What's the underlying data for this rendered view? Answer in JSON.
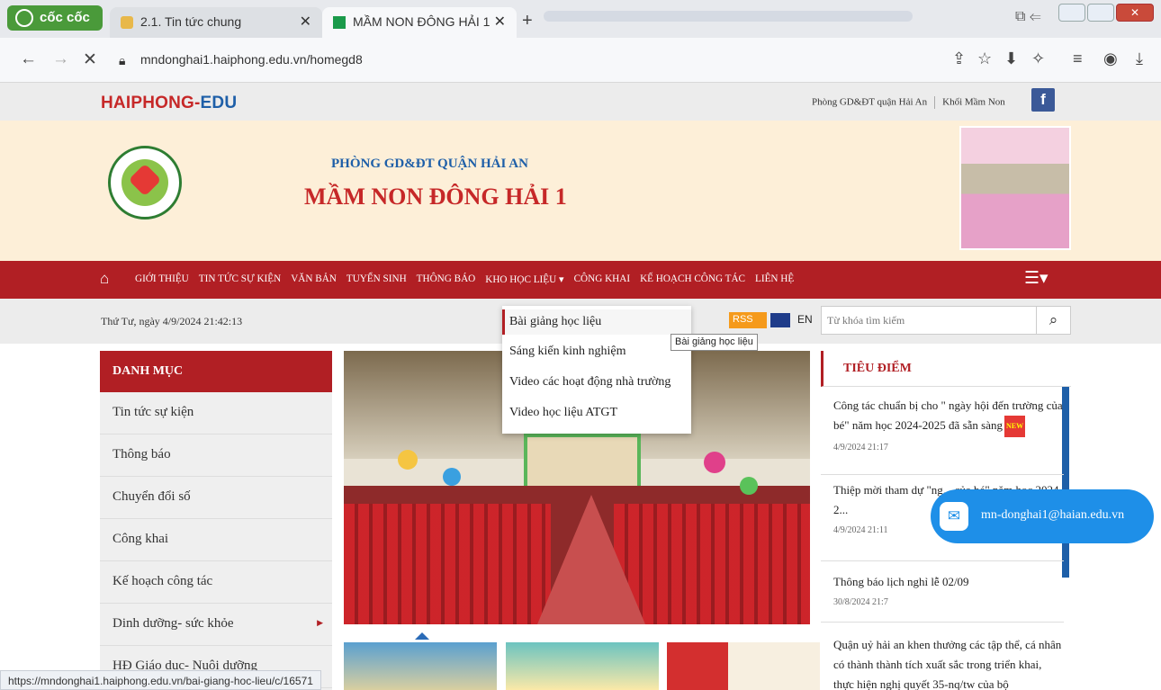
{
  "browser": {
    "brand": "cốc cốc",
    "tabs": [
      {
        "title": "2.1. Tin tức chung",
        "close": "✕"
      },
      {
        "title": "MẦM NON ĐÔNG HẢI 1",
        "close": "✕"
      }
    ],
    "new_tab": "+",
    "url": "mndonghai1.haiphong.edu.vn/homegd8"
  },
  "site": {
    "logo_main": "HAIPHONG-",
    "logo_edu": "EDU",
    "top_links": [
      "Phòng GD&ĐT quận Hải An",
      "Khối Mầm Non"
    ],
    "fb": "f"
  },
  "banner": {
    "subtitle": "PHÒNG GD&ĐT QUẬN HẢI AN",
    "title": "MẦM NON ĐÔNG HẢI 1"
  },
  "nav": {
    "items": [
      "GIỚI THIỆU",
      "TIN TỨC SỰ KIỆN",
      "VĂN BẢN",
      "TUYỂN SINH",
      "THÔNG BÁO",
      "KHO HỌC LIỆU ▾",
      "CÔNG KHAI",
      "KẾ HOẠCH CÔNG TÁC",
      "LIÊN HỆ"
    ],
    "burger": "☰▾"
  },
  "subbar": {
    "date": "Thứ Tư, ngày 4/9/2024 21:42:13",
    "rss": "RSS",
    "lang": "EN",
    "search_placeholder": "Từ khóa tìm kiếm"
  },
  "dropdown": {
    "items": [
      "Bài giảng học liệu",
      "Sáng kiến kinh nghiệm",
      "Video các hoạt động nhà trường",
      "Video học liệu ATGT"
    ],
    "tooltip": "Bài giảng học liệu"
  },
  "sidebar": {
    "heading": "DANH MỤC",
    "items": [
      "Tin tức sự kiện",
      "Thông báo",
      "Chuyển đổi số",
      "Công khai",
      "Kế hoạch công tác",
      "Dinh dưỡng- sức khỏe",
      "HĐ Giáo dục- Nuôi dưỡng"
    ]
  },
  "focus": {
    "heading": "TIÊU ĐIỂM",
    "news": [
      {
        "title": "Công tác chuẩn bị cho \" ngày hội đến trường của bé\" năm học 2024-2025 đã sẵn sàng",
        "date": "4/9/2024 21:17",
        "badge": "NEW"
      },
      {
        "title": "Thiệp mời tham dự \"ng... của bé\" năm học 2024-2...",
        "date": "4/9/2024 21:11"
      },
      {
        "title": "Thông báo lịch nghỉ lễ 02/09",
        "date": "30/8/2024 21:7"
      },
      {
        "title": "Quận uỷ hải an khen thưởng các tập thể, cá nhân có thành thành tích xuất sắc trong triển khai, thực hiện nghị quyết 35-nq/tw của bộ"
      }
    ]
  },
  "contact": {
    "email": "mn-donghai1@haian.edu.vn"
  },
  "status_url": "https://mndonghai1.haiphong.edu.vn/bai-giang-hoc-lieu/c/16571",
  "colors": {
    "primary_red": "#b11f24",
    "accent_blue": "#1e5fa8",
    "banner_bg": "#fdefd8"
  }
}
